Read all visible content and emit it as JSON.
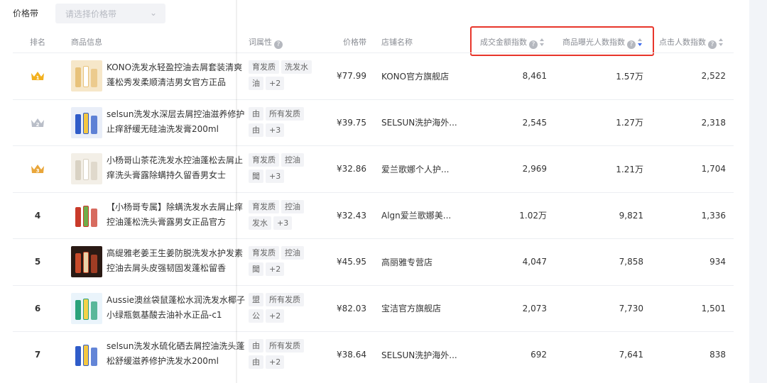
{
  "filter": {
    "label": "价格带",
    "placeholder": "请选择价格带"
  },
  "columns": {
    "rank": "排名",
    "product": "商品信息",
    "attrs": "词属性",
    "price": "价格带",
    "shop": "店铺名称",
    "gmv_index": "成交金额指数",
    "exposure_index": "商品曝光人数指数",
    "click_index": "点击人数指数",
    "help_glyph": "?"
  },
  "rows": [
    {
      "rank": "1",
      "rank_icon": "gold-crown-icon",
      "name": "KONO洗发水轻盈控油去屑套装清爽蓬松秀发柔顺清洁男女官方正品",
      "tags": [
        "育发质",
        "洗发水"
      ],
      "tag_extra": "油",
      "more": "+2",
      "price": "¥77.99",
      "shop": "KONO官方旗舰店",
      "gmv": "8,461",
      "exposure": "1.57万",
      "clicks": "2,522"
    },
    {
      "rank": "2",
      "rank_icon": "silver-crown-icon",
      "name": "selsun洗发水深层去屑控油滋养修护止痒舒缓无硅油洗发膏200ml",
      "tags": [
        "由",
        "所有发质"
      ],
      "tag_extra": "由",
      "more": "+3",
      "price": "¥39.75",
      "shop": "SELSUN洗护海外...",
      "gmv": "2,545",
      "exposure": "1.27万",
      "clicks": "2,318"
    },
    {
      "rank": "3",
      "rank_icon": "bronze-crown-icon",
      "name": "小杨哥山茶花洗发水控油蓬松去屑止痒洗头膏露除螨持久留香男女士",
      "tags": [
        "育发质",
        "控油"
      ],
      "tag_extra": "聞",
      "more": "+3",
      "price": "¥32.86",
      "shop": "爱兰歌娜个人护...",
      "gmv": "2,969",
      "exposure": "1.21万",
      "clicks": "1,704"
    },
    {
      "rank": "4",
      "rank_icon": "",
      "name": "【小杨哥专属】除螨洗发水去屑止痒控油蓬松洗头膏露男女正品官方",
      "tags": [
        "育发质",
        "控油"
      ],
      "tag_extra": "发水",
      "more": "+3",
      "price": "¥32.43",
      "shop": "Algn爱兰歌娜美...",
      "gmv": "1.02万",
      "exposure": "9,821",
      "clicks": "1,336"
    },
    {
      "rank": "5",
      "rank_icon": "",
      "name": "高缇雅老姜王生姜防脱洗发水护发素控油去屑头皮强韧固发蓬松留香",
      "tags": [
        "育发质",
        "控油"
      ],
      "tag_extra": "聞",
      "more": "+2",
      "price": "¥45.95",
      "shop": "高丽雅专营店",
      "gmv": "4,047",
      "exposure": "7,858",
      "clicks": "934"
    },
    {
      "rank": "6",
      "rank_icon": "",
      "name": "Aussie澳丝袋鼠蓬松水润洗发水椰子小绿瓶氨基酸去油补水正品-c1",
      "tags": [
        "盟",
        "所有发质"
      ],
      "tag_extra": "公",
      "more": "+2",
      "price": "¥82.03",
      "shop": "宝洁官方旗舰店",
      "gmv": "2,073",
      "exposure": "7,730",
      "clicks": "1,501"
    },
    {
      "rank": "7",
      "rank_icon": "",
      "name": "selsun洗发水硫化硒去屑控油洗头蓬松舒缓滋养修护洗发水200ml",
      "tags": [
        "由",
        "所有发质"
      ],
      "tag_extra": "由",
      "more": "+2",
      "price": "¥38.64",
      "shop": "SELSUN洗护海外...",
      "gmv": "692",
      "exposure": "7,641",
      "clicks": "838"
    }
  ],
  "colors": {
    "highlight_box": "#e8362b",
    "sort_active": "#3768f0",
    "gold": "#f2b01e",
    "silver": "#b9bec8",
    "bronze": "#e9a63a"
  }
}
